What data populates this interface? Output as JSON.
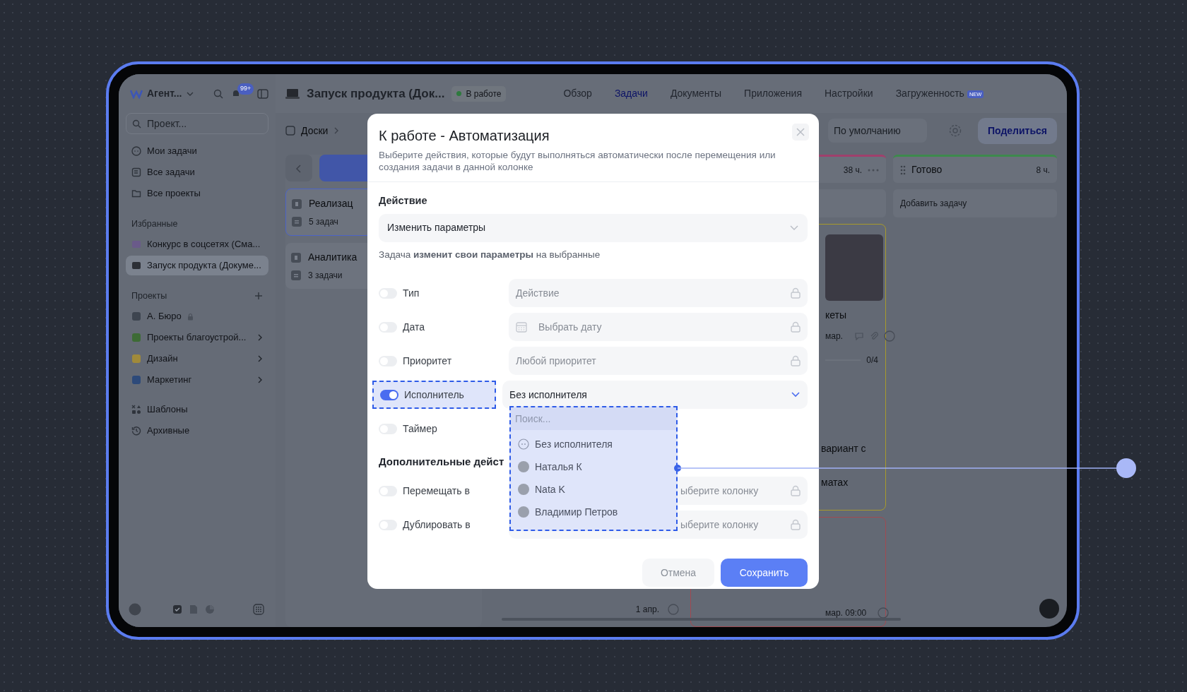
{
  "sidebar": {
    "workspace": "Агент...",
    "notifications": "99+",
    "search": {
      "placeholder": "Проект..."
    },
    "nav": [
      {
        "label": "Мои задачи"
      },
      {
        "label": "Все задачи"
      },
      {
        "label": "Все проекты"
      }
    ],
    "favorites_title": "Избранные",
    "favorites": [
      {
        "label": "Конкурс в соцсетях (Сма...",
        "selected": false
      },
      {
        "label": "Запуск продукта (Докуме...",
        "selected": true
      }
    ],
    "projects_title": "Проекты",
    "projects": [
      {
        "label": "А. Бюро",
        "locked": true,
        "expandable": false
      },
      {
        "label": "Проекты благоустрой...",
        "locked": false,
        "expandable": true
      },
      {
        "label": "Дизайн",
        "locked": false,
        "expandable": true
      },
      {
        "label": "Маркетинг",
        "locked": false,
        "expandable": true
      }
    ],
    "extra": [
      {
        "label": "Шаблоны"
      },
      {
        "label": "Архивные"
      }
    ]
  },
  "header": {
    "project": "Запуск продукта (Док...",
    "status": "В работе",
    "tabs": [
      {
        "label": "Обзор",
        "selected": false
      },
      {
        "label": "Задачи",
        "selected": true
      },
      {
        "label": "Документы",
        "selected": false
      },
      {
        "label": "Приложения",
        "selected": false
      },
      {
        "label": "Настройки",
        "selected": false
      },
      {
        "label": "Загруженность",
        "selected": false,
        "badge": "NEW"
      }
    ]
  },
  "toolbar": {
    "breadcrumb": "Доски",
    "view": "По умолчанию",
    "share": "Поделиться"
  },
  "board": {
    "left_cards": [
      {
        "title": "Реализац",
        "count": "5 задач",
        "selected": true
      },
      {
        "title": "Аналитика",
        "count": "3 задачи",
        "selected": false
      }
    ],
    "hidden_column_date": "1 апр.",
    "middle_column": {
      "hours": "38 ч.",
      "color": "#a0406c",
      "cards": [
        {
          "color": "#a89a2a",
          "lines": [
            "кеты"
          ],
          "date": "мар.",
          "progress": {
            "level": 0,
            "text": "0/4"
          },
          "text_lines": [
            "вариант с",
            "матах"
          ]
        },
        {
          "color": "#a04a52",
          "date": "мар. 09:00"
        }
      ]
    },
    "done_column": {
      "title": "Готово",
      "hours": "8 ч.",
      "color": "#3d8a4c",
      "add": "Добавить задачу"
    }
  },
  "modal": {
    "title": "К работе - Автоматизация",
    "subtitle": "Выберите действия, которые будут выполняться автоматически после перемещения или создания задачи в данной колонке",
    "action_label": "Действие",
    "action_value": "Изменить параметры",
    "hint": "Задача **изменит свои параметры** на выбранные",
    "params": [
      {
        "kind": "text",
        "label": "Тип",
        "on": false,
        "placeholder": "Действие",
        "locked": true,
        "highlighted": false
      },
      {
        "kind": "date",
        "label": "Дата",
        "on": false,
        "placeholder": "Выбрать дату",
        "locked": true,
        "highlighted": false
      },
      {
        "kind": "text",
        "label": "Приоритет",
        "on": false,
        "placeholder": "Любой приоритет",
        "locked": true,
        "highlighted": false
      },
      {
        "kind": "select",
        "label": "Исполнитель",
        "on": true,
        "value": "Без исполнителя",
        "locked": false,
        "highlighted": true
      },
      {
        "kind": "none",
        "label": "Таймер",
        "on": false,
        "highlighted": false
      }
    ],
    "extra_title": "Дополнительные дейст",
    "extra": [
      {
        "label": "Перемещать в",
        "on": false,
        "placeholder": "ыберите колонку",
        "locked": true
      },
      {
        "label": "Дублировать в",
        "on": false,
        "placeholder": "ыберите колонку",
        "locked": true
      }
    ],
    "cancel": "Отмена",
    "save": "Сохранить",
    "dropdown": {
      "placeholder": "Поиск...",
      "options": [
        {
          "kind": "none",
          "label": "Без исполнителя"
        },
        {
          "kind": "avatar",
          "label": "Наталья К"
        },
        {
          "kind": "avatar",
          "label": "Nata K"
        },
        {
          "kind": "avatar",
          "label": "Владимир Петров"
        }
      ]
    }
  }
}
